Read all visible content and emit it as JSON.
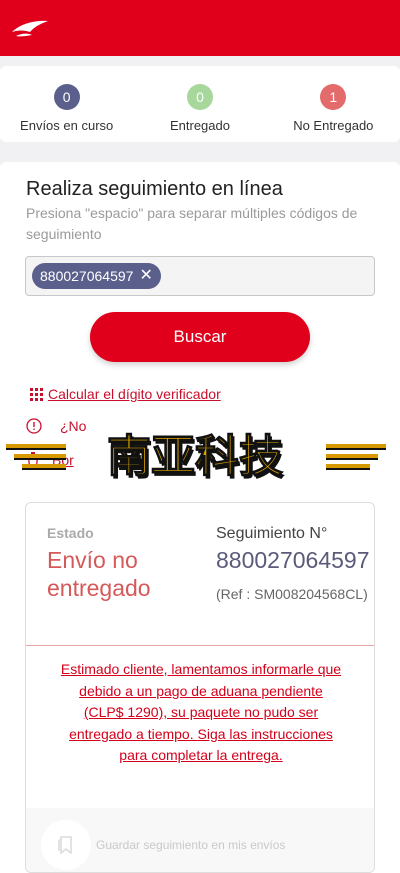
{
  "header": {
    "logo_icon": "bird-logo-icon",
    "color": "#e0001b"
  },
  "stats": [
    {
      "count": "0",
      "label": "Envíos en curso",
      "color": "#5b5f8c"
    },
    {
      "count": "0",
      "label": "Entregado",
      "color": "#a7d79a"
    },
    {
      "count": "1",
      "label": "No Entregado",
      "color": "#e46b6b"
    }
  ],
  "search": {
    "title": "Realiza seguimiento en línea",
    "hint": "Presiona \"espacio\" para separar múltiples códigos de seguimiento",
    "tag": "880027064597",
    "button": "Buscar",
    "link_calc": "Calcular el dígito verificador",
    "info_text": "¿No",
    "delete_text": "Bor"
  },
  "watermark": {
    "text": "南亚科技"
  },
  "result": {
    "estado_label": "Estado",
    "estado_value": "Envío no entregado",
    "seg_label": "Seguimiento N°",
    "seg_value": "880027064597",
    "ref": "(Ref : SM008204568CL)",
    "message": "Estimado cliente, lamentamos informarle que debido a un pago de aduana pendiente (CLP$ 1290), su paquete no pudo ser entregado a tiempo. Siga las instrucciones para completar la entrega.",
    "save_text": "Guardar seguimiento en mis envíos"
  }
}
